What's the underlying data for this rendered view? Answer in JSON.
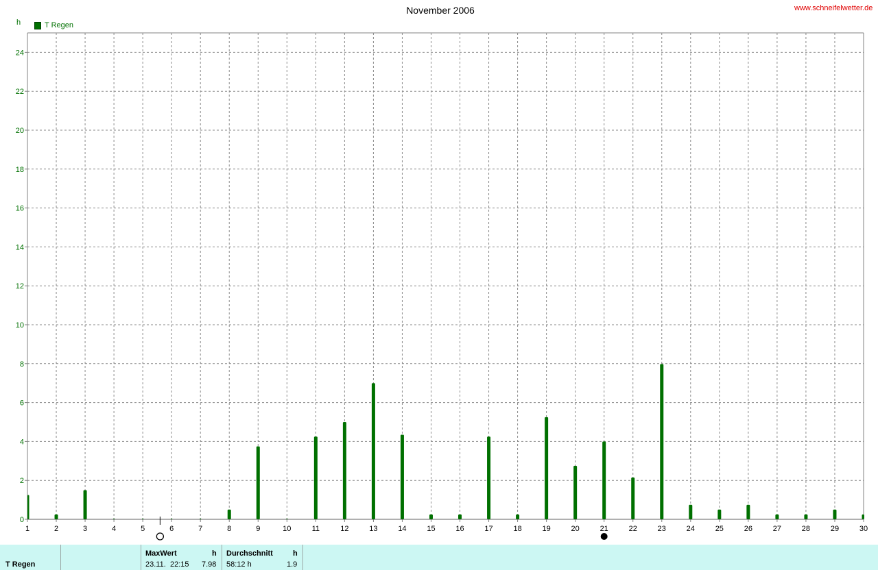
{
  "header": {
    "site": "www.schneifelwetter.de",
    "title": "November 2006",
    "unit": "h"
  },
  "legend": {
    "label": "T Regen",
    "color": "#007000"
  },
  "chart_data": {
    "type": "bar",
    "title": "November 2006",
    "ylabel": "h",
    "ylim": [
      0,
      25
    ],
    "yticks": [
      0,
      2,
      4,
      6,
      8,
      10,
      12,
      14,
      16,
      18,
      20,
      22,
      24
    ],
    "xlim": [
      1,
      30
    ],
    "categories": [
      "1",
      "2",
      "3",
      "4",
      "5",
      "6",
      "7",
      "8",
      "9",
      "10",
      "11",
      "12",
      "13",
      "14",
      "15",
      "16",
      "17",
      "18",
      "19",
      "20",
      "21",
      "22",
      "23",
      "24",
      "25",
      "26",
      "27",
      "28",
      "29",
      "30"
    ],
    "series": [
      {
        "name": "T Regen",
        "color": "#007000",
        "values": [
          1.25,
          0.25,
          1.5,
          0,
          0,
          0,
          0,
          0.5,
          3.75,
          0,
          4.25,
          5.0,
          7.0,
          4.35,
          0.25,
          0.25,
          4.25,
          0.25,
          5.25,
          2.75,
          4.0,
          2.15,
          7.98,
          0.75,
          0.5,
          0.75,
          0.25,
          0.25,
          0.5,
          0.25
        ]
      }
    ],
    "grid": true,
    "moon_phases": [
      {
        "day": 5.6,
        "phase": "full-moon"
      },
      {
        "day": 21,
        "phase": "new-moon"
      }
    ]
  },
  "stats": {
    "series_label": "T Regen",
    "max_header": "MaxWert",
    "max_unit": "h",
    "max_date": "23.11.",
    "max_time": "22:15",
    "max_value": "7.98",
    "avg_header": "Durchschnitt",
    "avg_unit": "h",
    "avg_total": "58:12 h",
    "avg_value": "1.9"
  }
}
